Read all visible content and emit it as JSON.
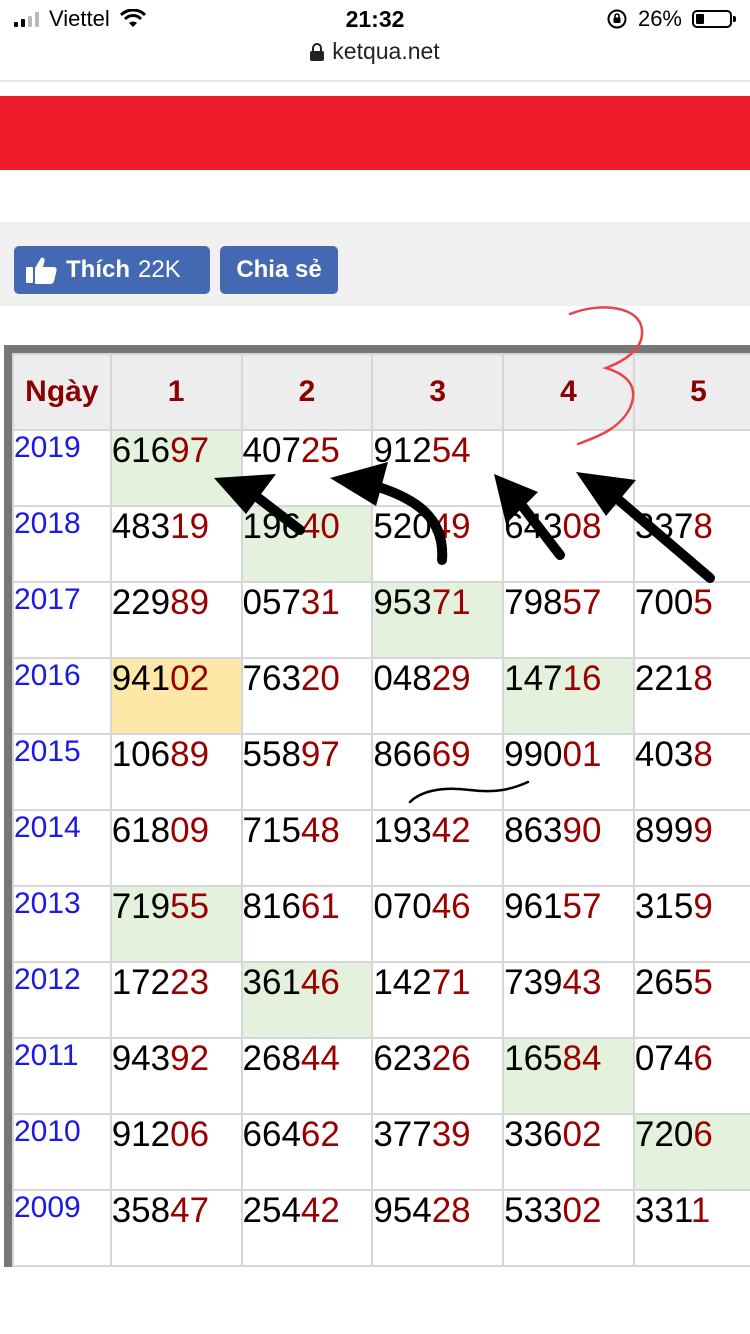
{
  "status_bar": {
    "carrier": "Viettel",
    "time": "21:32",
    "battery": "26%",
    "battery_level": 0.26,
    "icons": [
      "signal-icon",
      "wifi-icon",
      "orientation-lock-icon",
      "battery-icon"
    ]
  },
  "browser": {
    "url": "ketqua.net"
  },
  "social": {
    "like_label": "Thích",
    "like_count": "22K",
    "share_label": "Chia sẻ",
    "button_color": "#4568b2"
  },
  "colors": {
    "banner": "#ee1c2a",
    "year_text": "#1a1ae0",
    "header_text": "#8b0000",
    "tail_digits": "#9b0000",
    "highlight_green": "#e3f1dd",
    "highlight_yellow": "#fde8a8"
  },
  "table": {
    "headers": [
      "Ngày",
      "1",
      "2",
      "3",
      "4",
      "5"
    ],
    "rows": [
      {
        "year": "2019",
        "cells": [
          {
            "head": "616",
            "tail": "97",
            "hl": "green"
          },
          {
            "head": "407",
            "tail": "25"
          },
          {
            "head": "912",
            "tail": "54"
          },
          {
            "head": "",
            "tail": ""
          },
          {
            "head": "",
            "tail": ""
          }
        ]
      },
      {
        "year": "2018",
        "cells": [
          {
            "head": "483",
            "tail": "19"
          },
          {
            "head": "196",
            "tail": "40",
            "hl": "green"
          },
          {
            "head": "520",
            "tail": "49"
          },
          {
            "head": "643",
            "tail": "08"
          },
          {
            "head": "337",
            "tail": "8"
          }
        ]
      },
      {
        "year": "2017",
        "cells": [
          {
            "head": "229",
            "tail": "89"
          },
          {
            "head": "057",
            "tail": "31"
          },
          {
            "head": "953",
            "tail": "71",
            "hl": "green"
          },
          {
            "head": "798",
            "tail": "57"
          },
          {
            "head": "700",
            "tail": "5"
          }
        ]
      },
      {
        "year": "2016",
        "cells": [
          {
            "head": "941",
            "tail": "02",
            "hl": "yellow"
          },
          {
            "head": "763",
            "tail": "20"
          },
          {
            "head": "048",
            "tail": "29"
          },
          {
            "head": "147",
            "tail": "16",
            "hl": "green"
          },
          {
            "head": "221",
            "tail": "8"
          }
        ]
      },
      {
        "year": "2015",
        "cells": [
          {
            "head": "106",
            "tail": "89"
          },
          {
            "head": "558",
            "tail": "97"
          },
          {
            "head": "866",
            "tail": "69"
          },
          {
            "head": "990",
            "tail": "01"
          },
          {
            "head": "403",
            "tail": "8"
          }
        ]
      },
      {
        "year": "2014",
        "cells": [
          {
            "head": "618",
            "tail": "09"
          },
          {
            "head": "715",
            "tail": "48"
          },
          {
            "head": "193",
            "tail": "42"
          },
          {
            "head": "863",
            "tail": "90"
          },
          {
            "head": "899",
            "tail": "9"
          }
        ]
      },
      {
        "year": "2013",
        "cells": [
          {
            "head": "719",
            "tail": "55",
            "hl": "green"
          },
          {
            "head": "816",
            "tail": "61"
          },
          {
            "head": "070",
            "tail": "46"
          },
          {
            "head": "961",
            "tail": "57"
          },
          {
            "head": "315",
            "tail": "9"
          }
        ]
      },
      {
        "year": "2012",
        "cells": [
          {
            "head": "172",
            "tail": "23"
          },
          {
            "head": "361",
            "tail": "46",
            "hl": "green"
          },
          {
            "head": "142",
            "tail": "71"
          },
          {
            "head": "739",
            "tail": "43"
          },
          {
            "head": "265",
            "tail": "5"
          }
        ]
      },
      {
        "year": "2011",
        "cells": [
          {
            "head": "943",
            "tail": "92"
          },
          {
            "head": "268",
            "tail": "44"
          },
          {
            "head": "623",
            "tail": "26"
          },
          {
            "head": "165",
            "tail": "84",
            "hl": "green"
          },
          {
            "head": "074",
            "tail": "6"
          }
        ]
      },
      {
        "year": "2010",
        "cells": [
          {
            "head": "912",
            "tail": "06"
          },
          {
            "head": "664",
            "tail": "62"
          },
          {
            "head": "377",
            "tail": "39"
          },
          {
            "head": "336",
            "tail": "02"
          },
          {
            "head": "720",
            "tail": "6",
            "hl": "green"
          }
        ]
      },
      {
        "year": "2009",
        "cells": [
          {
            "head": "358",
            "tail": "47"
          },
          {
            "head": "254",
            "tail": "42"
          },
          {
            "head": "954",
            "tail": "28"
          },
          {
            "head": "533",
            "tail": "02"
          },
          {
            "head": "331",
            "tail": "1"
          }
        ]
      }
    ]
  },
  "annotations": {
    "handwritten_number": "3",
    "marker_red": "#e8454a",
    "arrow_color": "#000000"
  }
}
